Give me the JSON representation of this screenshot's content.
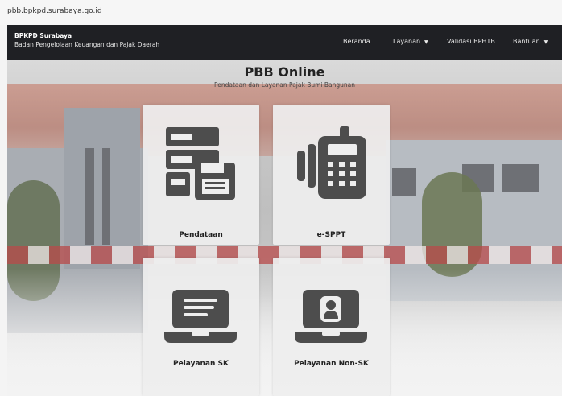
{
  "browser": {
    "url": "pbb.bpkpd.surabaya.go.id"
  },
  "navbar": {
    "brand_title": "BPKPD Surabaya",
    "brand_subtitle": "Badan Pengelolaan Keuangan dan Pajak Daerah",
    "items": [
      {
        "label": "Beranda",
        "has_dropdown": false
      },
      {
        "label": "Layanan",
        "has_dropdown": true
      },
      {
        "label": "Validasi BPHTB",
        "has_dropdown": false
      },
      {
        "label": "Bantuan",
        "has_dropdown": true
      }
    ],
    "caret": "▼"
  },
  "hero": {
    "title": "PBB Online",
    "subtitle": "Pendataan dan Layanan Pajak Bumi Bangunan"
  },
  "cards": [
    {
      "label": "Pendataan",
      "icon": "forms-floppy-icon"
    },
    {
      "label": "e-SPPT",
      "icon": "payment-terminal-icon"
    },
    {
      "label": "Pelayanan SK",
      "icon": "laptop-document-icon"
    },
    {
      "label": "Pelayanan Non-SK",
      "icon": "laptop-user-icon"
    }
  ],
  "colors": {
    "navbar": "#1f2024",
    "icon": "#4d4d4d",
    "card": "#eeeeee"
  }
}
